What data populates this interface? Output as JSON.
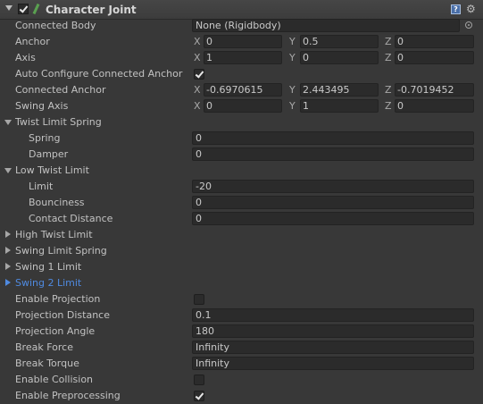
{
  "component": {
    "title": "Character Joint",
    "help_glyph": "?",
    "settings_glyph": "⚙"
  },
  "connected_body": {
    "label": "Connected Body",
    "value": "None (Rigidbody)"
  },
  "anchor": {
    "label": "Anchor",
    "x": "0",
    "y": "0.5",
    "z": "0"
  },
  "axis": {
    "label": "Axis",
    "x": "1",
    "y": "0",
    "z": "0"
  },
  "auto_configure": {
    "label": "Auto Configure Connected Anchor",
    "checked": true
  },
  "connected_anchor": {
    "label": "Connected Anchor",
    "x": "-0.6970615",
    "y": "2.443495",
    "z": "-0.7019452"
  },
  "swing_axis": {
    "label": "Swing Axis",
    "x": "0",
    "y": "1",
    "z": "0"
  },
  "axis_letters": {
    "x": "X",
    "y": "Y",
    "z": "Z"
  },
  "twist_limit_spring": {
    "label": "Twist Limit Spring",
    "expanded": true,
    "spring": {
      "label": "Spring",
      "value": "0"
    },
    "damper": {
      "label": "Damper",
      "value": "0"
    }
  },
  "low_twist_limit": {
    "label": "Low Twist Limit",
    "expanded": true,
    "limit": {
      "label": "Limit",
      "value": "-20"
    },
    "bounciness": {
      "label": "Bounciness",
      "value": "0"
    },
    "contact_distance": {
      "label": "Contact Distance",
      "value": "0"
    }
  },
  "high_twist_limit": {
    "label": "High Twist Limit",
    "expanded": false
  },
  "swing_limit_spring": {
    "label": "Swing Limit Spring",
    "expanded": false
  },
  "swing_1_limit": {
    "label": "Swing 1 Limit",
    "expanded": false
  },
  "swing_2_limit": {
    "label": "Swing 2 Limit",
    "expanded": false,
    "focused": true
  },
  "enable_projection": {
    "label": "Enable Projection",
    "checked": false
  },
  "projection_distance": {
    "label": "Projection Distance",
    "value": "0.1"
  },
  "projection_angle": {
    "label": "Projection Angle",
    "value": "180"
  },
  "break_force": {
    "label": "Break Force",
    "value": "Infinity"
  },
  "break_torque": {
    "label": "Break Torque",
    "value": "Infinity"
  },
  "enable_collision": {
    "label": "Enable Collision",
    "checked": false
  },
  "enable_preprocessing": {
    "label": "Enable Preprocessing",
    "checked": true
  },
  "colors": {
    "background": "#383838",
    "field": "#2b2b2b",
    "text": "#c2c2c2",
    "focus": "#4f8ae0"
  }
}
